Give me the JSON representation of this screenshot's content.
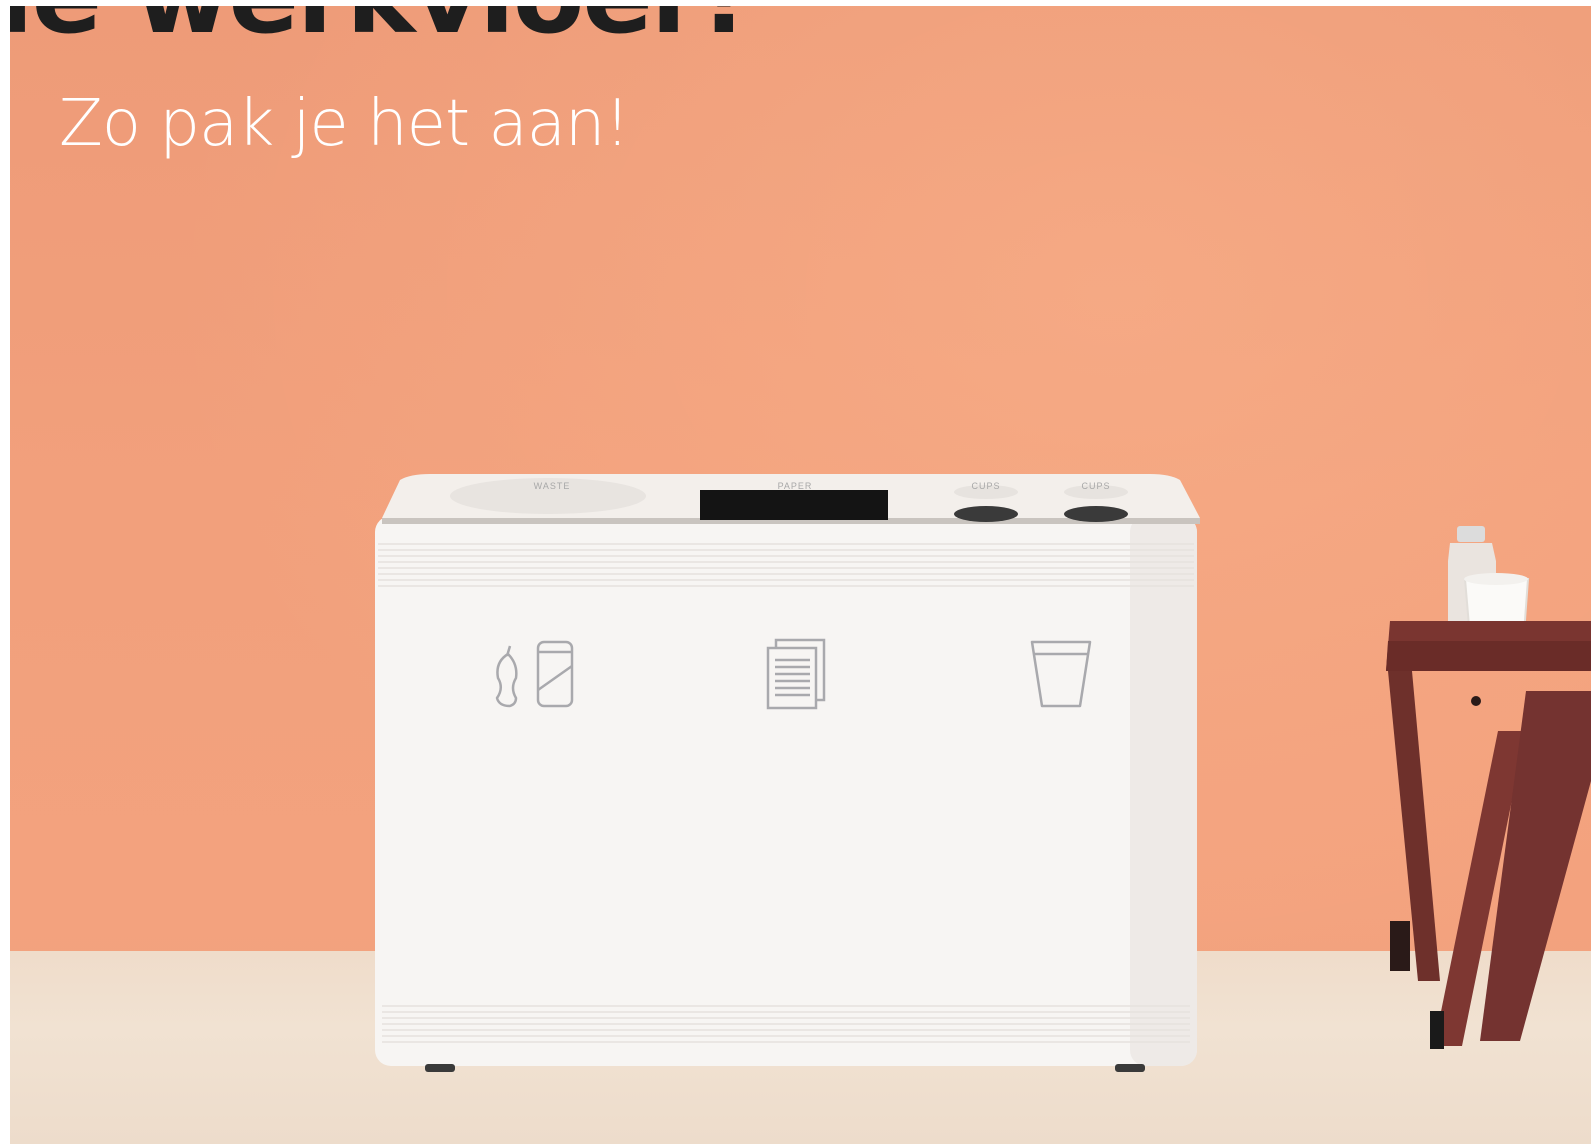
{
  "header": {
    "headline": "le werkvloer!",
    "subtitle": "Zo pak je het aan!"
  },
  "bin": {
    "compartments": [
      {
        "label": "WASTE",
        "icon": "organic-and-can-icon"
      },
      {
        "label": "PAPER",
        "icon": "paper-stack-icon"
      },
      {
        "label": "CUPS",
        "icon": "cup-icon"
      },
      {
        "label": "CUPS",
        "icon": "cup-icon"
      }
    ]
  },
  "colors": {
    "wall": "#f2a07c",
    "floor": "#efdcca",
    "bin": "#f7f5f3",
    "stool": "#7a3530",
    "headline": "#1e1e1e",
    "subtitle": "#ffffff"
  }
}
